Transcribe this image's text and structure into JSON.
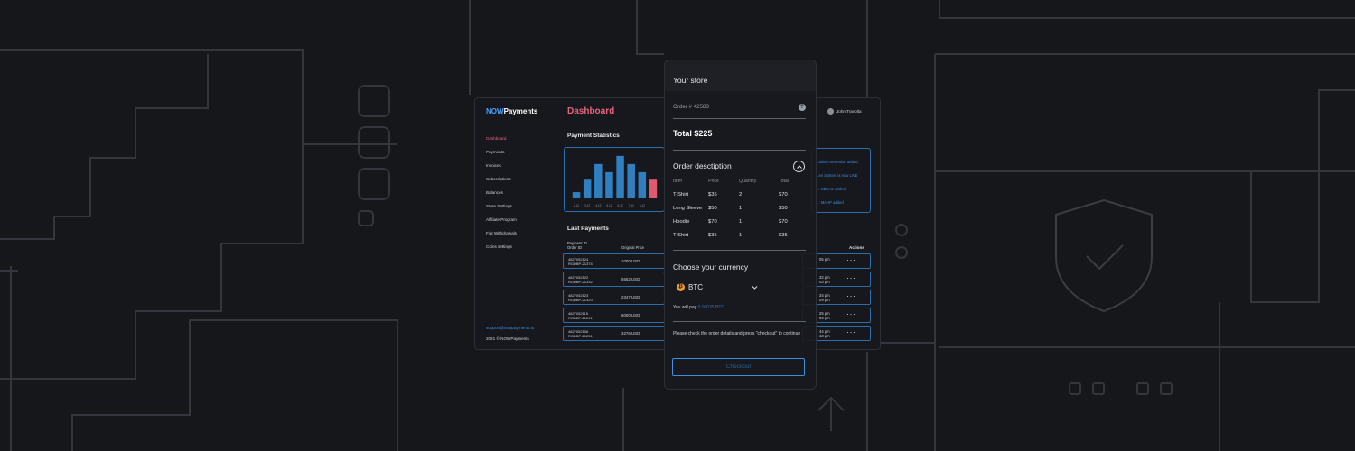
{
  "colors": {
    "background": "#15171b",
    "accent_blue": "#3d8fe0",
    "accent_pink": "#e8647e",
    "btc_orange": "#f39b2c"
  },
  "brand": {
    "prefix": "NOW",
    "suffix": "Payments"
  },
  "sidebar": {
    "items": [
      {
        "label": "Dashboard",
        "active": true
      },
      {
        "label": "Payments"
      },
      {
        "label": "Invoices"
      },
      {
        "label": "Subscriptions"
      },
      {
        "label": "Balances"
      },
      {
        "label": "Store Settings"
      },
      {
        "label": "Affiliate Program"
      },
      {
        "label": "Fiat Withdrawals"
      },
      {
        "label": "Coins settings"
      }
    ],
    "support_email": "support@nowpayments.io",
    "copyright": "2021 © NOWPayments"
  },
  "dashboard": {
    "title": "Dashboard",
    "stats_title": "Payment Statistics",
    "last_payments_title": "Last Payments",
    "columns": {
      "payment_id": "Payment ID",
      "order_id": "Order ID",
      "price": "Original Price",
      "actions": "Actions"
    },
    "payments": [
      {
        "payment_id": "4827052124",
        "order_id": "RGDBP-21374",
        "price": "1000 USD",
        "time": "05 pm"
      },
      {
        "payment_id": "4827052122",
        "order_id": "RGDBP-21332",
        "price": "5562 USD",
        "time": "32 pm"
      },
      {
        "payment_id": "4827052123",
        "order_id": "RGDBP-21323",
        "price": "2347 USD",
        "time": "34 pm"
      },
      {
        "payment_id": "4827052115",
        "order_id": "RGDBP-21291",
        "price": "6000 USD",
        "time": "25 pm"
      },
      {
        "payment_id": "4827052106",
        "order_id": "RGDBP-21251",
        "price": "3276 USD",
        "time": "44 pm"
      }
    ],
    "extra_times": [
      "",
      "03 pm",
      "09 pm",
      "03 pm",
      "13 pm"
    ],
    "user_name": "John Travolta",
    "notifications": [
      "...duits conversion added",
      "...en System is now LIVE",
      "...: SEKAS added",
      "...: MAHP added"
    ]
  },
  "chart_data": {
    "type": "bar",
    "categories": [
      "2.12",
      "3.12",
      "4.12",
      "5.12",
      "6.12",
      "7.12",
      "8.12"
    ],
    "values": [
      10,
      30,
      55,
      42,
      68,
      55,
      42
    ],
    "highlight_index": 7,
    "series_colors": {
      "normal": "#2f7fc1",
      "highlight": "#e0596f"
    },
    "extra_bar": {
      "label": "",
      "value": 30
    },
    "ylim": [
      0,
      75
    ],
    "title": "Payment Statistics"
  },
  "checkout": {
    "title": "Your store",
    "order_number": "Order # 42583",
    "help_icon": "?",
    "total": "Total $225",
    "description_title": "Order desctiption",
    "table_headers": [
      "Item",
      "Price",
      "Quantity",
      "Total"
    ],
    "items": [
      {
        "item": "T-Shirt",
        "price": "$35",
        "qty": "2",
        "total": "$70"
      },
      {
        "item": "Long Sleeve",
        "price": "$50",
        "qty": "1",
        "total": "$50"
      },
      {
        "item": "Hoodie",
        "price": "$70",
        "qty": "1",
        "total": "$70"
      },
      {
        "item": "T-Shirt",
        "price": "$35",
        "qty": "1",
        "total": "$35"
      }
    ],
    "currency_title": "Choose your currency",
    "currency_symbol": "₿",
    "currency": "BTC",
    "pay_prefix": "You will pay",
    "pay_amount": "0.00035 BTC",
    "hint": "Please check the order details and press \"checkout\" to continue",
    "checkout_label": "Checkout"
  }
}
